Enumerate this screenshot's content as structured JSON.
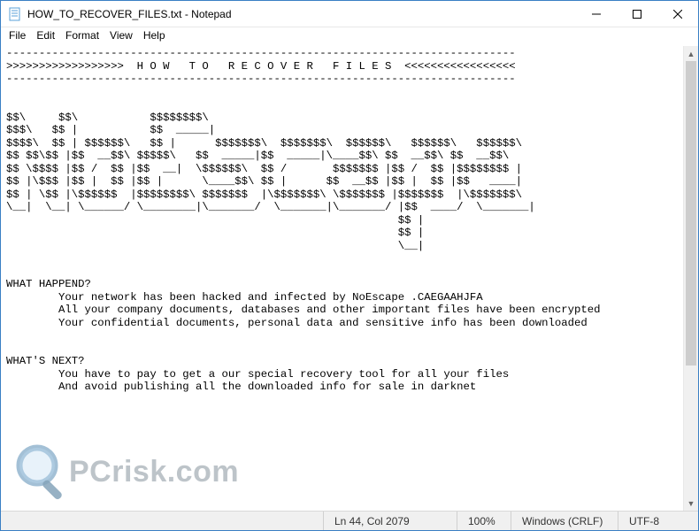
{
  "window": {
    "title": "HOW_TO_RECOVER_FILES.txt - Notepad"
  },
  "menu": {
    "file": "File",
    "edit": "Edit",
    "format": "Format",
    "view": "View",
    "help": "Help"
  },
  "document": {
    "hr": "------------------------------------------------------------------------------",
    "banner": ">>>>>>>>>>>>>>>>>>  H O W   T O   R E C O V E R   F I L E S  <<<<<<<<<<<<<<<<<",
    "ascii01": "$$\\     $$\\           $$$$$$$$\\",
    "ascii02": "$$$\\   $$ |           $$  _____|",
    "ascii03": "$$$$\\  $$ | $$$$$$\\   $$ |      $$$$$$$\\  $$$$$$$\\  $$$$$$\\   $$$$$$\\   $$$$$$\\",
    "ascii04": "$$ $$\\$$ |$$  __$$\\ $$$$$\\   $$  _____|$$  _____|\\____$$\\ $$  __$$\\ $$  __$$\\",
    "ascii05": "$$ \\$$$$ |$$ /  $$ |$$  __|  \\$$$$$$\\  $$ /       $$$$$$$ |$$ /  $$ |$$$$$$$$ |",
    "ascii06": "$$ |\\$$$ |$$ |  $$ |$$ |      \\____$$\\ $$ |      $$  __$$ |$$ |  $$ |$$   ____|",
    "ascii07": "$$ | \\$$ |\\$$$$$$  |$$$$$$$$\\ $$$$$$$  |\\$$$$$$$\\ \\$$$$$$$ |$$$$$$$  |\\$$$$$$$\\",
    "ascii08": "\\__|  \\__| \\______/ \\________|\\_______/  \\_______|\\_______/ |$$  ____/  \\_______|",
    "ascii09": "                                                            $$ |",
    "ascii10": "                                                            $$ |",
    "ascii11": "                                                            \\__|",
    "h1": "WHAT HAPPEND?",
    "p1a": "        Your network has been hacked and infected by NoEscape .CAEGAAHJFA",
    "p1b": "        All your company documents, databases and other important files have been encrypted",
    "p1c": "        Your confidential documents, personal data and sensitive info has been downloaded",
    "h2": "WHAT'S NEXT?",
    "p2a": "        You have to pay to get a our special recovery tool for all your files",
    "p2b": "        And avoid publishing all the downloaded info for sale in darknet"
  },
  "status": {
    "position": "Ln 44, Col 2079",
    "zoom": "100%",
    "eol": "Windows (CRLF)",
    "encoding": "UTF-8"
  },
  "watermark": {
    "text": "PCrisk.com"
  }
}
